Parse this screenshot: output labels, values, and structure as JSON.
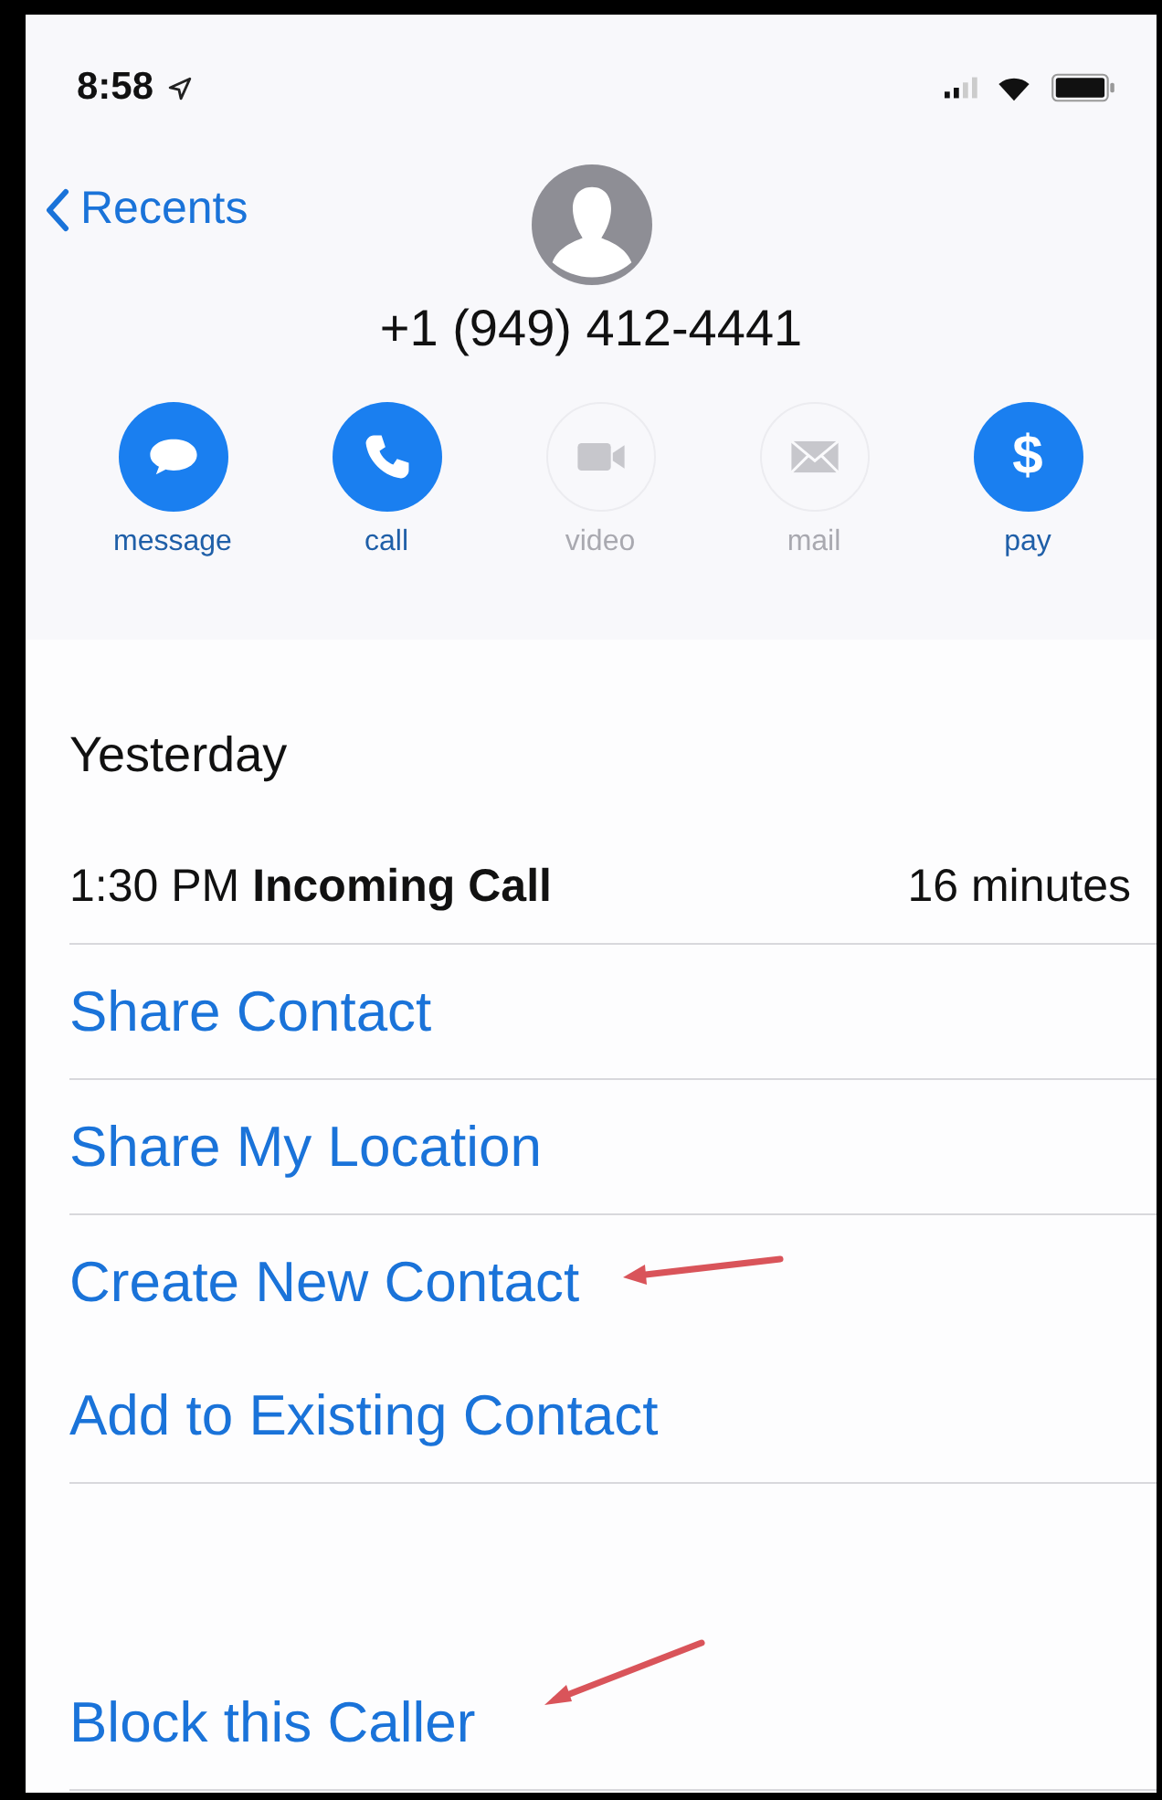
{
  "status_bar": {
    "time": "8:58"
  },
  "nav": {
    "back_label": "Recents"
  },
  "contact": {
    "number": "+1 (949) 412-4441"
  },
  "actions": [
    {
      "kind": "message",
      "label": "message",
      "enabled": true
    },
    {
      "kind": "call",
      "label": "call",
      "enabled": true
    },
    {
      "kind": "video",
      "label": "video",
      "enabled": false
    },
    {
      "kind": "mail",
      "label": "mail",
      "enabled": false
    },
    {
      "kind": "pay",
      "label": "pay",
      "glyph": "$",
      "enabled": true
    }
  ],
  "history": {
    "day": "Yesterday",
    "entry": "1:30 PM **Incoming Call**",
    "duration": "16 minutes"
  },
  "menu_groups": [
    {
      "items": [
        {
          "label": "Share Contact",
          "annotated": false
        }
      ]
    },
    {
      "items": [
        {
          "label": "Share My Location",
          "annotated": false
        }
      ]
    },
    {
      "items": [
        {
          "label": "Create New Contact",
          "annotated": true
        },
        {
          "label": "Add to Existing Contact",
          "annotated": false
        }
      ]
    },
    {
      "items": [
        {
          "label": "Block this Caller",
          "annotated": true
        }
      ]
    }
  ]
}
